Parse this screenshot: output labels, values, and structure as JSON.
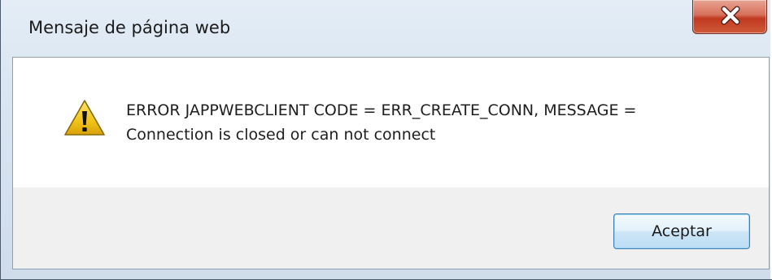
{
  "window": {
    "title": "Mensaje de página web"
  },
  "titlebar": {
    "close_icon": "close-x-icon"
  },
  "message": {
    "icon": "warning-triangle-icon",
    "line1": "ERROR JAPPWEBCLIENT CODE = ERR_CREATE_CONN, MESSAGE =",
    "line2": "Connection is closed or can not connect"
  },
  "buttons": {
    "ok_label": "Aceptar"
  },
  "colors": {
    "close_button": "#c7462b",
    "warning_yellow": "#f2c418",
    "ok_button_border": "#3c7fb1"
  }
}
